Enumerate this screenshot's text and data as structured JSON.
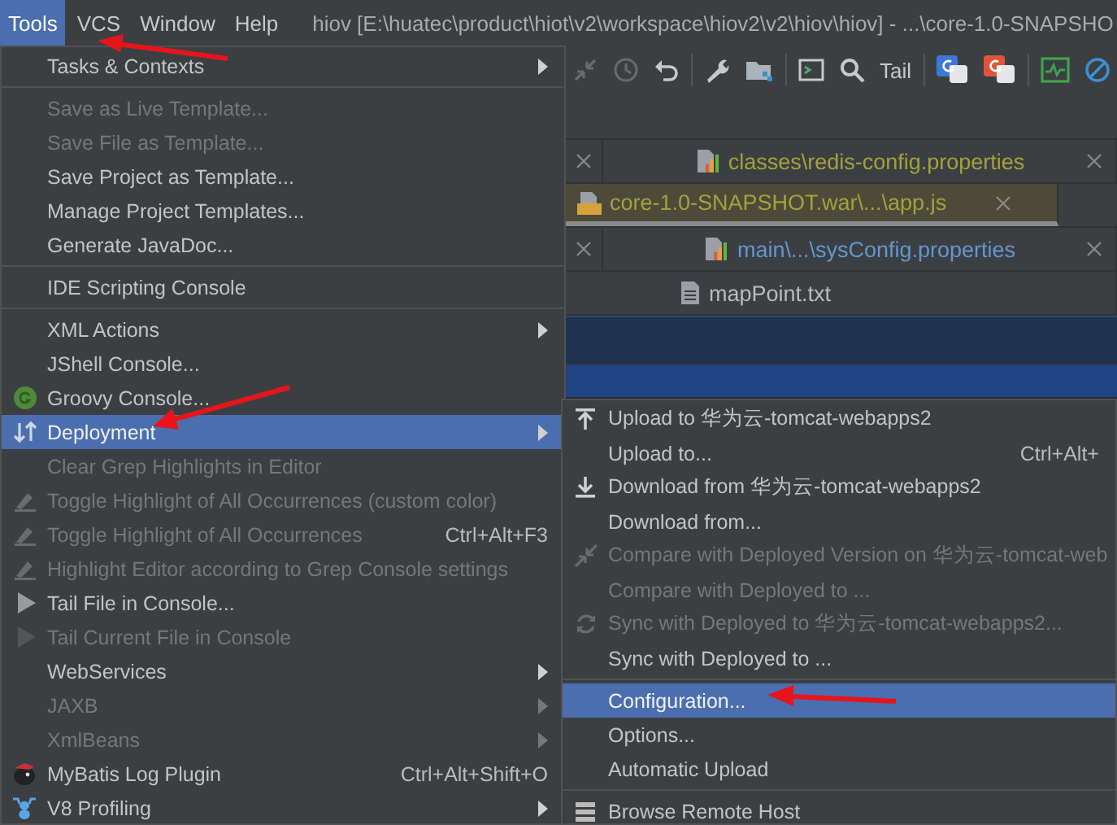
{
  "menubar": {
    "items": [
      {
        "label": "Tools",
        "selected": true
      },
      {
        "label": "VCS",
        "selected": false
      },
      {
        "label": "Window",
        "selected": false
      },
      {
        "label": "Help",
        "selected": false
      }
    ],
    "title": "hiov [E:\\huatec\\product\\hiot\\v2\\workspace\\hiov2\\v2\\hiov\\hiov] - ...\\core-1.0-SNAPSHO"
  },
  "toolbar": {
    "items": [
      {
        "kind": "collapse",
        "disabled": true
      },
      {
        "kind": "clock",
        "disabled": true
      },
      {
        "kind": "undo",
        "disabled": false
      },
      {
        "kind": "separator"
      },
      {
        "kind": "wrench",
        "disabled": false
      },
      {
        "kind": "folder",
        "disabled": false
      },
      {
        "kind": "separator"
      },
      {
        "kind": "terminal",
        "disabled": false
      },
      {
        "kind": "search",
        "disabled": false
      },
      {
        "kind": "text",
        "label": "Tail",
        "disabled": false
      },
      {
        "kind": "separator"
      },
      {
        "kind": "translate",
        "color": "#3b78d8",
        "disabled": false
      },
      {
        "kind": "translate",
        "color": "#e0553a",
        "disabled": false
      },
      {
        "kind": "separator"
      },
      {
        "kind": "monitor",
        "disabled": false
      },
      {
        "kind": "block",
        "disabled": false
      }
    ]
  },
  "editor_tabs": {
    "rows": [
      {
        "tabs": [
          {
            "kind": "stub",
            "selected": false
          },
          {
            "kind": "properties",
            "label": "classes\\redis-config.properties",
            "color": "#a3a13c",
            "selected": false
          }
        ]
      },
      {
        "tabs": [
          {
            "kind": "js",
            "label": "core-1.0-SNAPSHOT.war\\...\\app.js",
            "color": "#a3a13c",
            "selected": true
          }
        ]
      },
      {
        "tabs": [
          {
            "kind": "stub",
            "selected": false
          },
          {
            "kind": "properties",
            "label": "main\\...\\sysConfig.properties",
            "color": "#6396d0",
            "selected": false
          }
        ]
      },
      {
        "tabs": [
          {
            "kind": "text",
            "label": "mapPoint.txt",
            "color": "#bbbbbb",
            "selected": false
          }
        ]
      }
    ]
  },
  "tools_menu": {
    "items": [
      {
        "kind": "plain",
        "label": "Tasks & Contexts",
        "disabled": false,
        "selected": false,
        "submenu": true
      },
      {
        "kind": "separator"
      },
      {
        "kind": "plain",
        "label": "Save as Live Template...",
        "disabled": true,
        "selected": false,
        "submenu": false
      },
      {
        "kind": "plain",
        "label": "Save File as Template...",
        "disabled": true,
        "selected": false,
        "submenu": false
      },
      {
        "kind": "plain",
        "label": "Save Project as Template...",
        "disabled": false,
        "selected": false,
        "submenu": false
      },
      {
        "kind": "plain",
        "label": "Manage Project Templates...",
        "disabled": false,
        "selected": false,
        "submenu": false
      },
      {
        "kind": "plain",
        "label": "Generate JavaDoc...",
        "disabled": false,
        "selected": false,
        "submenu": false
      },
      {
        "kind": "separator"
      },
      {
        "kind": "plain",
        "label": "IDE Scripting Console",
        "disabled": false,
        "selected": false,
        "submenu": false
      },
      {
        "kind": "separator"
      },
      {
        "kind": "plain",
        "label": "XML Actions",
        "disabled": false,
        "selected": false,
        "submenu": true
      },
      {
        "kind": "plain",
        "label": "JShell Console...",
        "disabled": false,
        "selected": false,
        "submenu": false
      },
      {
        "kind": "groovy",
        "label": "Groovy Console...",
        "disabled": false,
        "selected": false,
        "submenu": false
      },
      {
        "kind": "deployment",
        "label": "Deployment",
        "disabled": false,
        "selected": true,
        "submenu": true
      },
      {
        "kind": "plain",
        "label": "Clear Grep Highlights in Editor",
        "disabled": true,
        "selected": false,
        "submenu": false
      },
      {
        "kind": "highlight",
        "label": "Toggle Highlight of All Occurrences (custom color)",
        "disabled": true,
        "selected": false,
        "submenu": false
      },
      {
        "kind": "highlight",
        "label": "Toggle Highlight of All Occurrences",
        "shortcut": "Ctrl+Alt+F3",
        "disabled": true,
        "selected": false,
        "submenu": false
      },
      {
        "kind": "highlight",
        "label": "Highlight Editor according to Grep Console settings",
        "disabled": true,
        "selected": false,
        "submenu": false
      },
      {
        "kind": "tail",
        "label": "Tail File in Console...",
        "disabled": false,
        "selected": false,
        "submenu": false
      },
      {
        "kind": "tail",
        "label": "Tail Current File in Console",
        "disabled": true,
        "selected": false,
        "submenu": false
      },
      {
        "kind": "plain",
        "label": "WebServices",
        "disabled": false,
        "selected": false,
        "submenu": true
      },
      {
        "kind": "plain",
        "label": "JAXB",
        "disabled": true,
        "selected": false,
        "submenu": true
      },
      {
        "kind": "plain",
        "label": "XmlBeans",
        "disabled": true,
        "selected": false,
        "submenu": true
      },
      {
        "kind": "mybatis",
        "label": "MyBatis Log Plugin",
        "shortcut": "Ctrl+Alt+Shift+O",
        "disabled": false,
        "selected": false,
        "submenu": false
      },
      {
        "kind": "v8",
        "label": "V8 Profiling",
        "disabled": false,
        "selected": false,
        "submenu": true
      }
    ]
  },
  "deployment_submenu": {
    "items": [
      {
        "kind": "upload",
        "label": "Upload to 华为云-tomcat-webapps2",
        "disabled": false,
        "selected": false,
        "submenu": false
      },
      {
        "kind": "plain",
        "label": "Upload to...",
        "shortcut": "Ctrl+Alt+",
        "disabled": false,
        "selected": false,
        "submenu": false
      },
      {
        "kind": "download",
        "label": "Download from 华为云-tomcat-webapps2",
        "disabled": false,
        "selected": false,
        "submenu": false
      },
      {
        "kind": "plain",
        "label": "Download from...",
        "disabled": false,
        "selected": false,
        "submenu": false
      },
      {
        "kind": "compare",
        "label": "Compare with Deployed Version on 华为云-tomcat-web",
        "disabled": true,
        "selected": false,
        "submenu": false
      },
      {
        "kind": "plain",
        "label": "Compare with Deployed to ...",
        "disabled": true,
        "selected": false,
        "submenu": false
      },
      {
        "kind": "sync",
        "label": "Sync with Deployed to 华为云-tomcat-webapps2...",
        "disabled": true,
        "selected": false,
        "submenu": false
      },
      {
        "kind": "plain",
        "label": "Sync with Deployed to ...",
        "disabled": false,
        "selected": false,
        "submenu": false
      },
      {
        "kind": "separator"
      },
      {
        "kind": "plain",
        "label": "Configuration...",
        "disabled": false,
        "selected": true,
        "submenu": false
      },
      {
        "kind": "plain",
        "label": "Options...",
        "disabled": false,
        "selected": false,
        "submenu": false
      },
      {
        "kind": "plain",
        "label": "Automatic Upload",
        "disabled": false,
        "selected": false,
        "submenu": false
      },
      {
        "kind": "separator"
      },
      {
        "kind": "server",
        "label": "Browse Remote Host",
        "disabled": false,
        "selected": false,
        "submenu": false
      }
    ]
  }
}
